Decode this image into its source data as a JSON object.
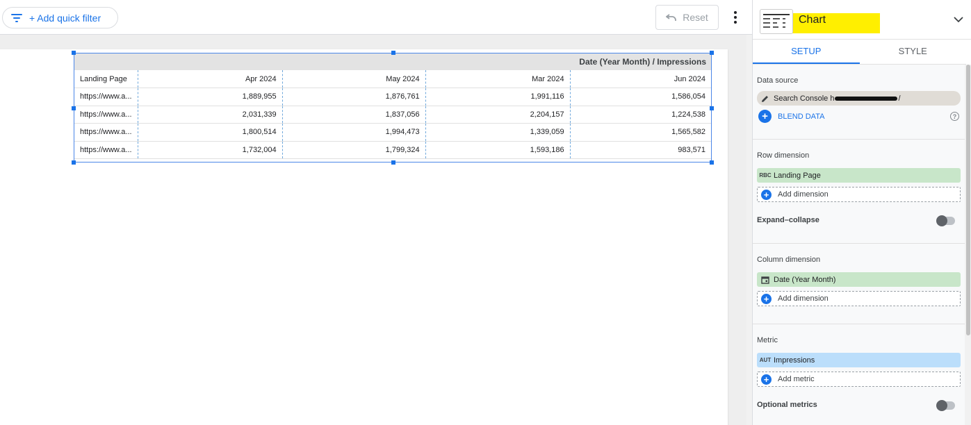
{
  "toolbar": {
    "quick_filter_label": "+ Add quick filter",
    "reset_label": "Reset"
  },
  "table": {
    "column_dimension_header": "Date (Year Month) / Impressions",
    "columns": [
      "Landing Page",
      "Apr 2024",
      "May 2024",
      "Mar 2024",
      "Jun 2024"
    ],
    "rows": [
      [
        "https://www.a...",
        "1,889,955",
        "1,876,761",
        "1,991,116",
        "1,586,054"
      ],
      [
        "https://www.a...",
        "2,031,339",
        "1,837,056",
        "2,204,157",
        "1,224,538"
      ],
      [
        "https://www.a...",
        "1,800,514",
        "1,994,473",
        "1,339,059",
        "1,565,582"
      ],
      [
        "https://www.a...",
        "1,732,004",
        "1,799,324",
        "1,593,186",
        "983,571"
      ]
    ]
  },
  "panel": {
    "chart_type_label": "Chart",
    "tabs": [
      {
        "label": "SETUP",
        "active": true
      },
      {
        "label": "STYLE",
        "active": false
      }
    ],
    "data_source": {
      "title": "Data source",
      "source_prefix": "Search Console h",
      "source_suffix": "/",
      "blend_label": "BLEND DATA"
    },
    "row_dimension": {
      "title": "Row dimension",
      "chip_type": "RBC",
      "chip_label": "Landing Page",
      "add_label": "Add dimension",
      "expand_collapse_label": "Expand–collapse"
    },
    "column_dimension": {
      "title": "Column dimension",
      "chip_label": "Date (Year Month)",
      "add_label": "Add dimension"
    },
    "metric": {
      "title": "Metric",
      "chip_type": "AUT",
      "chip_label": "Impressions",
      "add_label": "Add metric",
      "optional_label": "Optional metrics"
    }
  },
  "colors": {
    "accent": "#1a73e8",
    "dimension_chip": "#c8e6c9",
    "metric_chip": "#bbdefb",
    "highlight": "#ffef00"
  }
}
